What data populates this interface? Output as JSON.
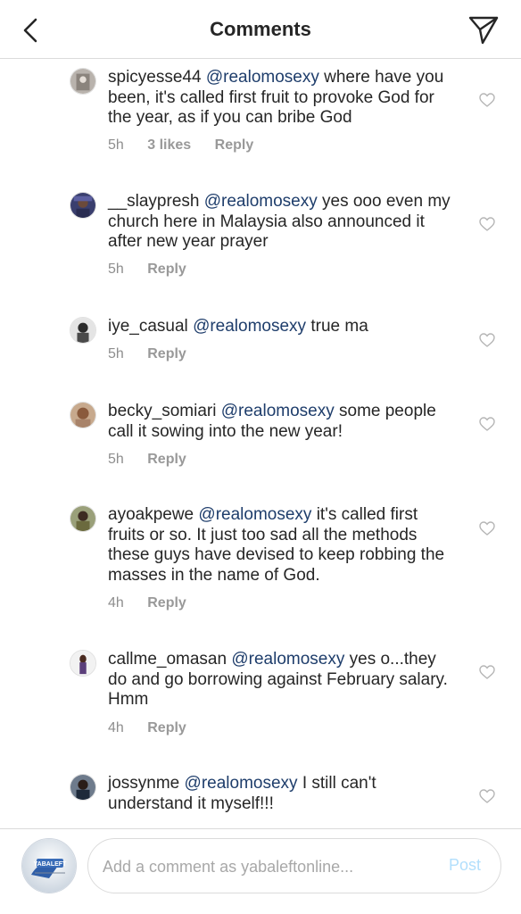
{
  "header": {
    "title": "Comments"
  },
  "comments": [
    {
      "username": "spicyesse44",
      "mention": "@realomosexy",
      "text": "where have you been, it's called first fruit to provoke God for the year, as if you can bribe God",
      "time": "5h",
      "likes": "3 likes",
      "reply": "Reply"
    },
    {
      "username": "__slaypresh",
      "mention": "@realomosexy",
      "text": "yes ooo even my church here in Malaysia also announced it after new year prayer",
      "time": "5h",
      "reply": "Reply"
    },
    {
      "username": "iye_casual",
      "mention": "@realomosexy",
      "text": "true ma",
      "time": "5h",
      "reply": "Reply"
    },
    {
      "username": "becky_somiari",
      "mention": "@realomosexy",
      "text": "some people call it sowing into the new year!",
      "time": "5h",
      "reply": "Reply"
    },
    {
      "username": "ayoakpewe",
      "mention": "@realomosexy",
      "text": "it's called first fruits or so. It just too sad all the methods these guys have devised to keep robbing the masses in the name of God.",
      "time": "4h",
      "reply": "Reply"
    },
    {
      "username": "callme_omasan",
      "mention": "@realomosexy",
      "text": "yes o...they do and go borrowing against February salary. Hmm",
      "time": "4h",
      "reply": "Reply"
    },
    {
      "username": "jossynme",
      "mention": "@realomosexy",
      "text": "I still can't understand it myself!!!"
    }
  ],
  "composer": {
    "placeholder": "Add a comment as yabaleftonline...",
    "post_label": "Post",
    "avatar_logo": "YABALEFT"
  },
  "icons": {
    "back": "chevron-left-icon",
    "share": "paper-plane-icon",
    "like": "heart-outline-icon"
  },
  "colors": {
    "mention": "#1e3d6b",
    "meta": "#8e8e8e",
    "post_disabled": "#b2dffc"
  }
}
